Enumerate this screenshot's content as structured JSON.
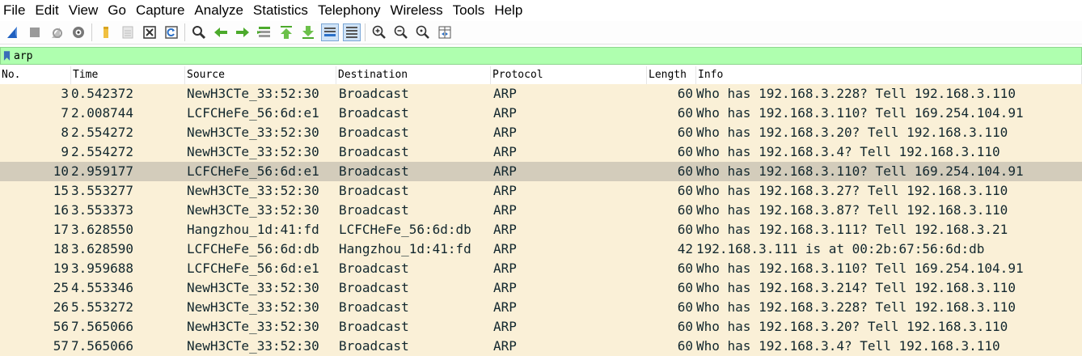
{
  "menubar": [
    "File",
    "Edit",
    "View",
    "Go",
    "Capture",
    "Analyze",
    "Statistics",
    "Telephony",
    "Wireless",
    "Tools",
    "Help"
  ],
  "toolbar_icons": [
    "shark-fin-start-icon",
    "stop-capture-icon",
    "restart-capture-icon",
    "capture-options-icon",
    "open-file-icon",
    "save-file-icon",
    "close-file-icon",
    "reload-file-icon",
    "find-packet-icon",
    "go-back-icon",
    "go-forward-icon",
    "go-to-packet-icon",
    "go-first-icon",
    "go-last-icon",
    "autoscroll-icon",
    "colorize-icon",
    "zoom-in-icon",
    "zoom-out-icon",
    "zoom-normal-icon",
    "resize-columns-icon"
  ],
  "filter": {
    "value": "arp"
  },
  "columns": [
    "No.",
    "Time",
    "Source",
    "Destination",
    "Protocol",
    "Length",
    "Info"
  ],
  "packets": [
    {
      "no": "3",
      "time": "0.542372",
      "src": "NewH3CTe_33:52:30",
      "dst": "Broadcast",
      "proto": "ARP",
      "len": "60",
      "info": "Who has 192.168.3.228? Tell 192.168.3.110"
    },
    {
      "no": "7",
      "time": "2.008744",
      "src": "LCFCHeFe_56:6d:e1",
      "dst": "Broadcast",
      "proto": "ARP",
      "len": "60",
      "info": "Who has 192.168.3.110? Tell 169.254.104.91"
    },
    {
      "no": "8",
      "time": "2.554272",
      "src": "NewH3CTe_33:52:30",
      "dst": "Broadcast",
      "proto": "ARP",
      "len": "60",
      "info": "Who has 192.168.3.20? Tell 192.168.3.110"
    },
    {
      "no": "9",
      "time": "2.554272",
      "src": "NewH3CTe_33:52:30",
      "dst": "Broadcast",
      "proto": "ARP",
      "len": "60",
      "info": "Who has 192.168.3.4? Tell 192.168.3.110"
    },
    {
      "no": "10",
      "time": "2.959177",
      "src": "LCFCHeFe_56:6d:e1",
      "dst": "Broadcast",
      "proto": "ARP",
      "len": "60",
      "info": "Who has 192.168.3.110? Tell 169.254.104.91",
      "selected": true
    },
    {
      "no": "15",
      "time": "3.553277",
      "src": "NewH3CTe_33:52:30",
      "dst": "Broadcast",
      "proto": "ARP",
      "len": "60",
      "info": "Who has 192.168.3.27? Tell 192.168.3.110"
    },
    {
      "no": "16",
      "time": "3.553373",
      "src": "NewH3CTe_33:52:30",
      "dst": "Broadcast",
      "proto": "ARP",
      "len": "60",
      "info": "Who has 192.168.3.87? Tell 192.168.3.110"
    },
    {
      "no": "17",
      "time": "3.628550",
      "src": "Hangzhou_1d:41:fd",
      "dst": "LCFCHeFe_56:6d:db",
      "proto": "ARP",
      "len": "60",
      "info": "Who has 192.168.3.111? Tell 192.168.3.21"
    },
    {
      "no": "18",
      "time": "3.628590",
      "src": "LCFCHeFe_56:6d:db",
      "dst": "Hangzhou_1d:41:fd",
      "proto": "ARP",
      "len": "42",
      "info": "192.168.3.111 is at 00:2b:67:56:6d:db"
    },
    {
      "no": "19",
      "time": "3.959688",
      "src": "LCFCHeFe_56:6d:e1",
      "dst": "Broadcast",
      "proto": "ARP",
      "len": "60",
      "info": "Who has 192.168.3.110? Tell 169.254.104.91"
    },
    {
      "no": "25",
      "time": "4.553346",
      "src": "NewH3CTe_33:52:30",
      "dst": "Broadcast",
      "proto": "ARP",
      "len": "60",
      "info": "Who has 192.168.3.214? Tell 192.168.3.110"
    },
    {
      "no": "26",
      "time": "5.553272",
      "src": "NewH3CTe_33:52:30",
      "dst": "Broadcast",
      "proto": "ARP",
      "len": "60",
      "info": "Who has 192.168.3.228? Tell 192.168.3.110"
    },
    {
      "no": "56",
      "time": "7.565066",
      "src": "NewH3CTe_33:52:30",
      "dst": "Broadcast",
      "proto": "ARP",
      "len": "60",
      "info": "Who has 192.168.3.20? Tell 192.168.3.110"
    },
    {
      "no": "57",
      "time": "7.565066",
      "src": "NewH3CTe_33:52:30",
      "dst": "Broadcast",
      "proto": "ARP",
      "len": "60",
      "info": "Who has 192.168.3.4? Tell 192.168.3.110"
    }
  ],
  "colors": {
    "arp_row_bg": "#faf0d7",
    "selected_row_bg": "#d3ccbb",
    "row_text": "#12272e",
    "filter_valid_bg": "#afffaf"
  }
}
